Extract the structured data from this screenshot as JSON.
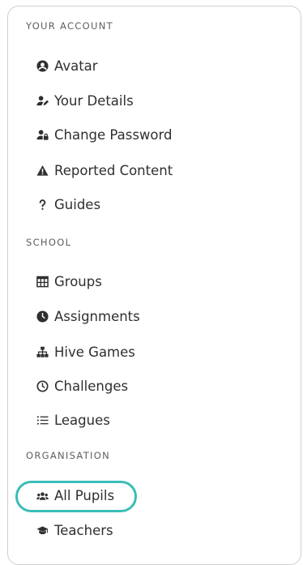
{
  "sections": [
    {
      "heading": "YOUR ACCOUNT",
      "items": [
        {
          "label": "Avatar",
          "icon": "user-circle-icon"
        },
        {
          "label": "Your Details",
          "icon": "user-edit-icon"
        },
        {
          "label": "Change Password",
          "icon": "user-lock-icon"
        },
        {
          "label": "Reported Content",
          "icon": "warning-triangle-icon"
        },
        {
          "label": "Guides",
          "icon": "question-mark-icon"
        }
      ]
    },
    {
      "heading": "SCHOOL",
      "items": [
        {
          "label": "Groups",
          "icon": "table-grid-icon"
        },
        {
          "label": "Assignments",
          "icon": "clock-filled-icon"
        },
        {
          "label": "Hive Games",
          "icon": "sitemap-icon"
        },
        {
          "label": "Challenges",
          "icon": "clock-outline-icon"
        },
        {
          "label": "Leagues",
          "icon": "list-icon"
        }
      ]
    },
    {
      "heading": "ORGANISATION",
      "items": [
        {
          "label": "All Pupils",
          "icon": "users-icon"
        },
        {
          "label": "Teachers",
          "icon": "graduation-cap-icon"
        }
      ]
    }
  ],
  "highlight": {
    "target": "All Pupils",
    "color": "#3bbdb7"
  }
}
